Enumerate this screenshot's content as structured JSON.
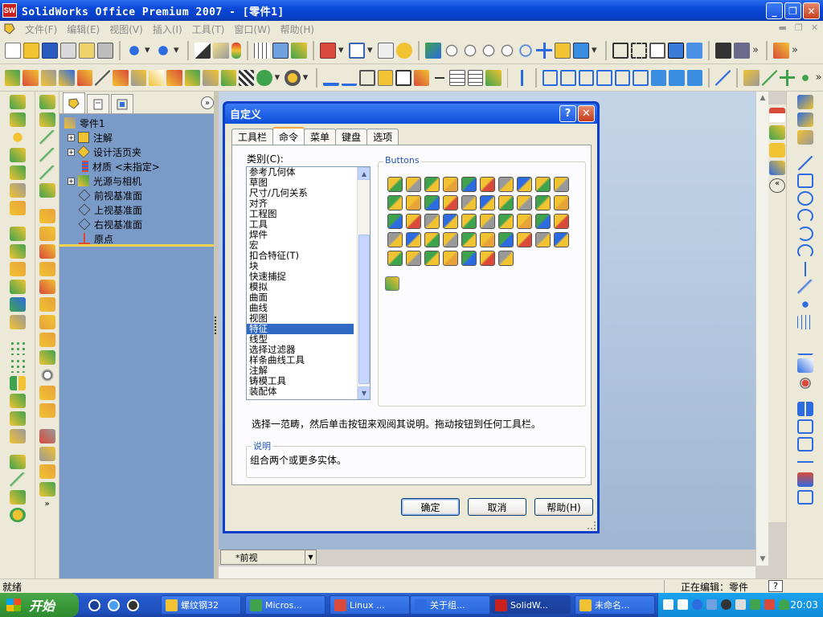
{
  "window": {
    "app_logo": "SW",
    "title": "SolidWorks Office Premium 2007 - [零件1]",
    "controls": [
      "_",
      "❐",
      "✕"
    ]
  },
  "menubar": {
    "items": [
      "文件(F)",
      "编辑(E)",
      "视图(V)",
      "插入(I)",
      "工具(T)",
      "窗口(W)",
      "帮助(H)"
    ]
  },
  "feature_manager": {
    "tree": [
      {
        "label": "零件1",
        "expander": "",
        "icon": "part-icon"
      },
      {
        "label": "注解",
        "expander": "+",
        "icon": "annotation-icon"
      },
      {
        "label": "设计活页夹",
        "expander": "+",
        "icon": "design-binder-icon"
      },
      {
        "label": "材质 <未指定>",
        "expander": "",
        "icon": "material-icon"
      },
      {
        "label": "光源与相机",
        "expander": "+",
        "icon": "lights-camera-icon"
      },
      {
        "label": "前视基准面",
        "expander": "",
        "icon": "plane-icon"
      },
      {
        "label": "上视基准面",
        "expander": "",
        "icon": "plane-icon"
      },
      {
        "label": "右视基准面",
        "expander": "",
        "icon": "plane-icon"
      },
      {
        "label": "原点",
        "expander": "",
        "icon": "origin-icon"
      }
    ],
    "collapse_glyph": "»"
  },
  "dialog": {
    "title": "自定义",
    "help_glyph": "?",
    "close_glyph": "✕",
    "tabs": [
      "工具栏",
      "命令",
      "菜单",
      "键盘",
      "选项"
    ],
    "active_tab": "命令",
    "categories_label": "类别(C):",
    "categories": [
      "参考几何体",
      "草图",
      "尺寸/几何关系",
      "对齐",
      "工程图",
      "工具",
      "焊件",
      "宏",
      "扣合特征(T)",
      "块",
      "快速捕捉",
      "模拟",
      "曲面",
      "曲线",
      "视图",
      "特征",
      "线型",
      "选择过滤器",
      "样条曲线工具",
      "注解",
      "铸模工具",
      "装配体"
    ],
    "selected_category": "特征",
    "buttons_group_label": "Buttons",
    "hint": "选择一范畴，然后单击按钮来观阅其说明。拖动按钮到任何工具栏。",
    "description_label": "说明",
    "description": "组合两个或更多实体。",
    "ok": "确定",
    "cancel": "取消",
    "help": "帮助(H)"
  },
  "view_tab": {
    "label": "*前视"
  },
  "status": {
    "left": "就绪",
    "right": "正在编辑：零件",
    "help_glyph": "?"
  },
  "taskbar": {
    "start": "开始",
    "tasks": [
      "螺纹钢32",
      "Micros...",
      "Linux ...",
      "关于组...",
      "SolidW...",
      "未命名..."
    ],
    "active_task": "SolidW...",
    "clock": "20:03"
  },
  "colors": {
    "xp_blue": "#0a49d8",
    "selection": "#316ac5",
    "feature_manager_bg": "#7a9bc8",
    "viewport_top": "#c5d5e8",
    "icon_yellow": "#f1c232",
    "icon_green": "#3fa34d"
  }
}
